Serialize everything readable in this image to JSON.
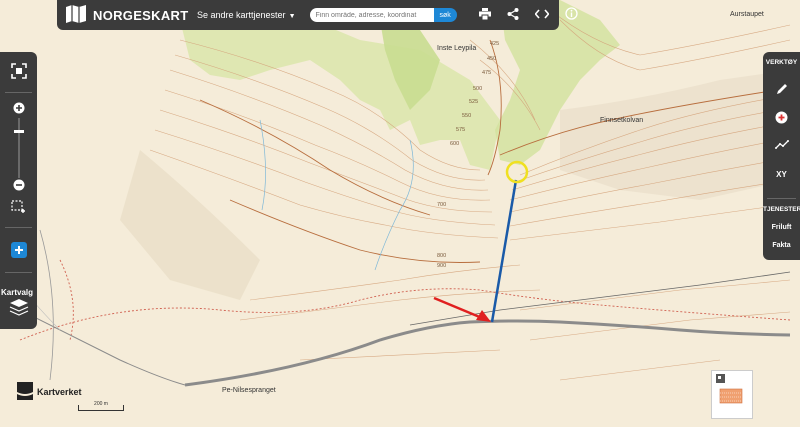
{
  "header": {
    "logo_text": "NORGESKART",
    "services_label": "Se andre karttjenester",
    "search_placeholder": "Finn område, adresse, koordinat",
    "search_button": "søk"
  },
  "left_toolbar": {
    "kartvalg_label": "Kartvalg"
  },
  "right_toolbar": {
    "tools_header": "VERKTØY",
    "xy_label": "XY",
    "services_header": "TJENESTER",
    "friluft_label": "Friluft",
    "fakta_label": "Fakta"
  },
  "map": {
    "place_labels": {
      "aurstaupet": "Aurstaupet",
      "inste_leypila": "Inste Leypila",
      "finnsetkolvan": "Finnsetkolvan",
      "pe_nilsespranget": "Pe-Nilsespranget"
    },
    "contour_labels": {
      "c425": "425",
      "c450": "450",
      "c475": "475",
      "c500": "500",
      "c525": "525",
      "c550": "550",
      "c575": "575",
      "c600": "600",
      "c700": "700",
      "c800": "800",
      "c900": "900"
    },
    "annotation_colors": {
      "arrow": "#e02020",
      "line": "#1a5aa8",
      "circle": "#f0e020"
    }
  },
  "footer": {
    "brand": "Kartverket",
    "scale_label": "200 m"
  }
}
